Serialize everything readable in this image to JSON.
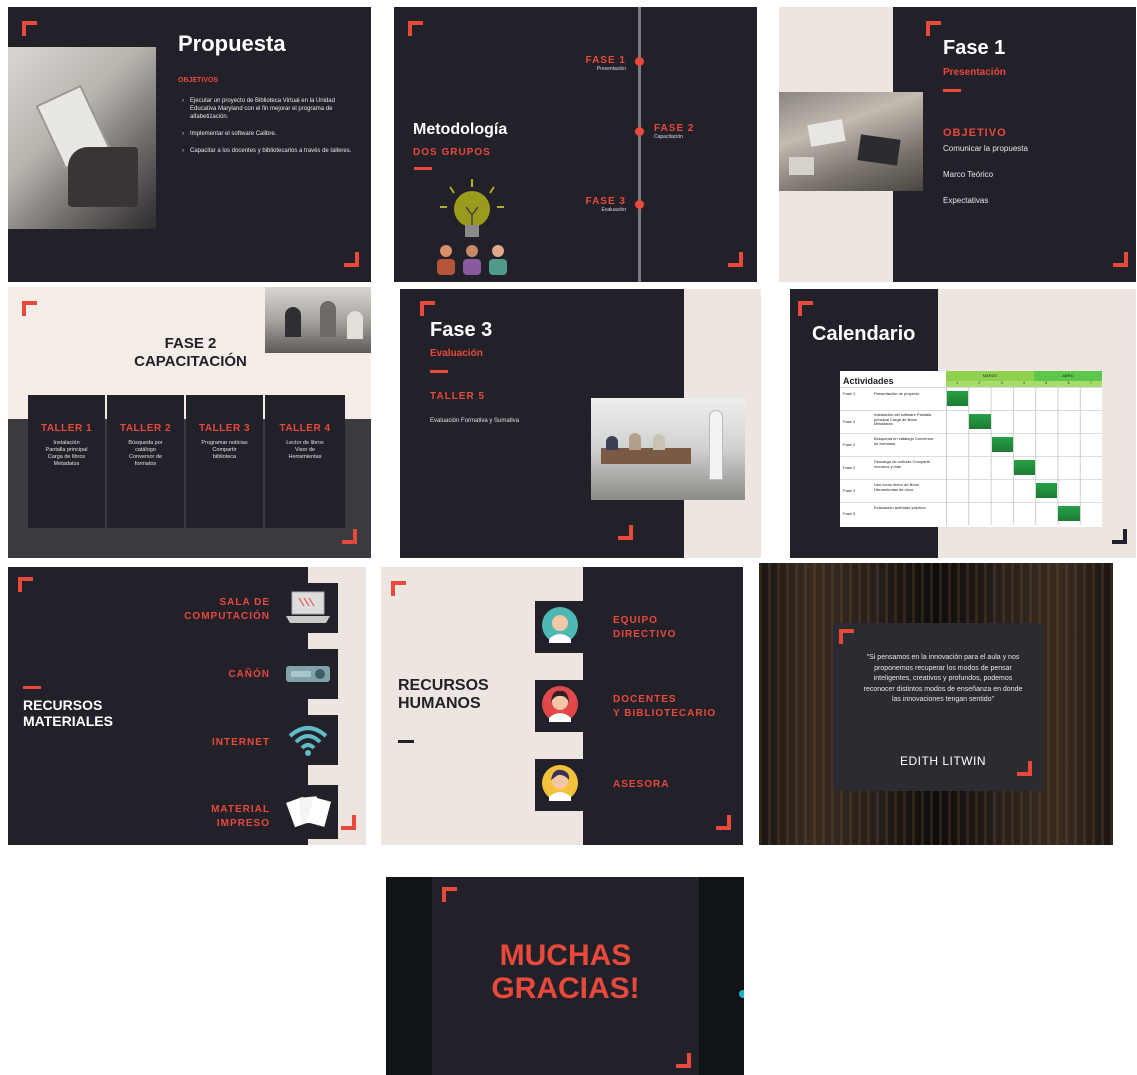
{
  "propuesta": {
    "title": "Propuesta",
    "label": "OBJETIVOS",
    "bullets": [
      "Ejecutar un proyecto de Biblioteca Virtual en la Unidad Educativa Maryland con el fin mejorar el programa de alfabetización.",
      "Implementar el software Calibre.",
      "Capacitar a los docentes y bibliotecarios a través de talleres."
    ]
  },
  "metodologia": {
    "title": "Metodología",
    "subtitle": "DOS GRUPOS",
    "phases": [
      {
        "name": "FASE 1",
        "desc": "Presentación"
      },
      {
        "name": "FASE 2",
        "desc": "Capacitación"
      },
      {
        "name": "FASE 3",
        "desc": "Evaluación"
      }
    ]
  },
  "fase1": {
    "title": "Fase 1",
    "subtitle": "Presentación",
    "label": "OBJETIVO",
    "items": [
      "Comunicar la propuesta",
      "Marco Teórico",
      "Expectativas"
    ]
  },
  "fase2": {
    "title1": "FASE 2",
    "title2": "CAPACITACIÓN",
    "talleres": [
      {
        "name": "TALLER 1",
        "items": [
          "Instalación",
          "Pantalla principal",
          "Carga de libros",
          "Metadatos"
        ]
      },
      {
        "name": "TALLER 2",
        "items": [
          "Búsqueda por",
          "catálogo",
          "Conversor de",
          "formatos"
        ]
      },
      {
        "name": "TALLER 3",
        "items": [
          "Programar noticias",
          "Compartir",
          "biblioteca"
        ]
      },
      {
        "name": "TALLER 4",
        "items": [
          "Lector de libros",
          "Visor de",
          "Herramientas"
        ]
      }
    ]
  },
  "fase3": {
    "title": "Fase 3",
    "subtitle": "Evaluación",
    "label": "TALLER 5",
    "desc": "Evaluación Formativa y Sumativa"
  },
  "calendario": {
    "title": "Calendario",
    "header": "Actividades",
    "months": [
      "MARZO",
      "ABRIL"
    ],
    "weeks": [
      "1",
      "2",
      "3",
      "4",
      "5",
      "6",
      "7"
    ],
    "rows": [
      {
        "fase": "Fase 1",
        "act": "Presentación de proyecto",
        "week": 1
      },
      {
        "fase": "Fase 2",
        "act": "Instalación del software Pantalla principal Carga de libros Metadatos",
        "week": 2
      },
      {
        "fase": "Fase 2",
        "act": "Búsqueda en catálogo Conversor de formatos",
        "week": 3
      },
      {
        "fase": "Fase 2",
        "act": "Descarga de noticias Compartir recursos y más",
        "week": 4
      },
      {
        "fase": "Fase 2",
        "act": "Uso como lector de libros Herramientas de visor",
        "week": 5
      },
      {
        "fase": "Fase 3",
        "act": "Evaluación actividad práctica",
        "week": 6
      }
    ]
  },
  "recursos_materiales": {
    "title1": "RECURSOS",
    "title2": "MATERIALES",
    "items": [
      [
        "SALA DE",
        "COMPUTACIÓN"
      ],
      [
        "CAÑÓN"
      ],
      [
        "INTERNET"
      ],
      [
        "MATERIAL",
        "IMPRESO"
      ]
    ]
  },
  "recursos_humanos": {
    "title1": "RECURSOS",
    "title2": "HUMANOS",
    "items": [
      [
        "EQUIPO",
        "DIRECTIVO"
      ],
      [
        "DOCENTES",
        "Y BIBLIOTECARIO"
      ],
      [
        "ASESORA"
      ]
    ]
  },
  "cita": {
    "quote": "\"Si pensamos en la innovación para el aula y nos proponemos recuperar los modos de pensar inteligentes, creativos y profundos, podemos reconocer distintos modos de enseñanza en donde las innovaciones tengan sentido\"",
    "author": "EDITH LITWIN"
  },
  "gracias": {
    "line1": "MUCHAS",
    "line2": "GRACIAS!"
  },
  "colors": {
    "accent": "#e8493b",
    "dark": "#22212a",
    "cream": "#ede5e0",
    "green": "#2e9a44"
  }
}
